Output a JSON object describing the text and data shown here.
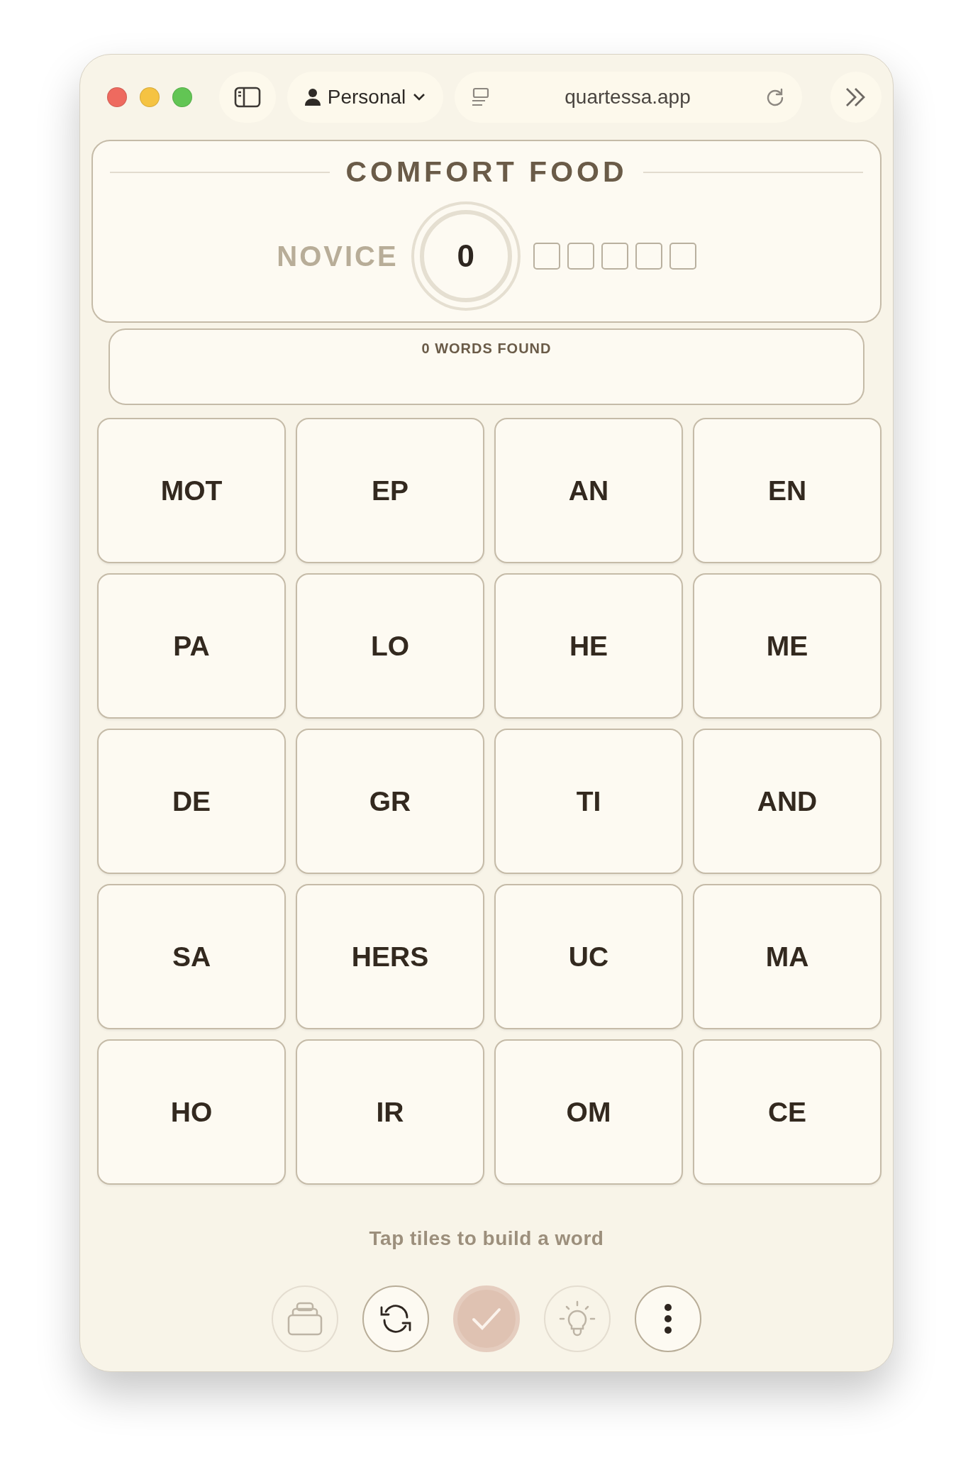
{
  "browser": {
    "profile": "Personal",
    "url": "quartessa.app"
  },
  "puzzle": {
    "title": "COMFORT FOOD",
    "rank": "NOVICE",
    "score": "0",
    "progress_boxes": [
      {
        "filled": false
      },
      {
        "filled": false
      },
      {
        "filled": false
      },
      {
        "filled": false
      },
      {
        "filled": false
      }
    ]
  },
  "words_found": {
    "label": "0 WORDS FOUND"
  },
  "tiles": [
    {
      "text": "MOT",
      "selected": false
    },
    {
      "text": "EP",
      "selected": false
    },
    {
      "text": "AN",
      "selected": false
    },
    {
      "text": "EN",
      "selected": false
    },
    {
      "text": "PA",
      "selected": false
    },
    {
      "text": "LO",
      "selected": false
    },
    {
      "text": "HE",
      "selected": false
    },
    {
      "text": "ME",
      "selected": false
    },
    {
      "text": "DE",
      "selected": false
    },
    {
      "text": "GR",
      "selected": false
    },
    {
      "text": "TI",
      "selected": false
    },
    {
      "text": "AND",
      "selected": false
    },
    {
      "text": "SA",
      "selected": false
    },
    {
      "text": "HERS",
      "selected": false
    },
    {
      "text": "UC",
      "selected": false
    },
    {
      "text": "MA",
      "selected": false
    },
    {
      "text": "HO",
      "selected": false
    },
    {
      "text": "IR",
      "selected": false
    },
    {
      "text": "OM",
      "selected": false
    },
    {
      "text": "CE",
      "selected": false
    }
  ],
  "hint": "Tap tiles to build a word",
  "actions": [
    {
      "kind": "stack",
      "disabled": true
    },
    {
      "kind": "shuffle",
      "disabled": false
    },
    {
      "kind": "submit",
      "disabled": true
    },
    {
      "kind": "hint",
      "disabled": true
    },
    {
      "kind": "more",
      "disabled": false
    }
  ]
}
